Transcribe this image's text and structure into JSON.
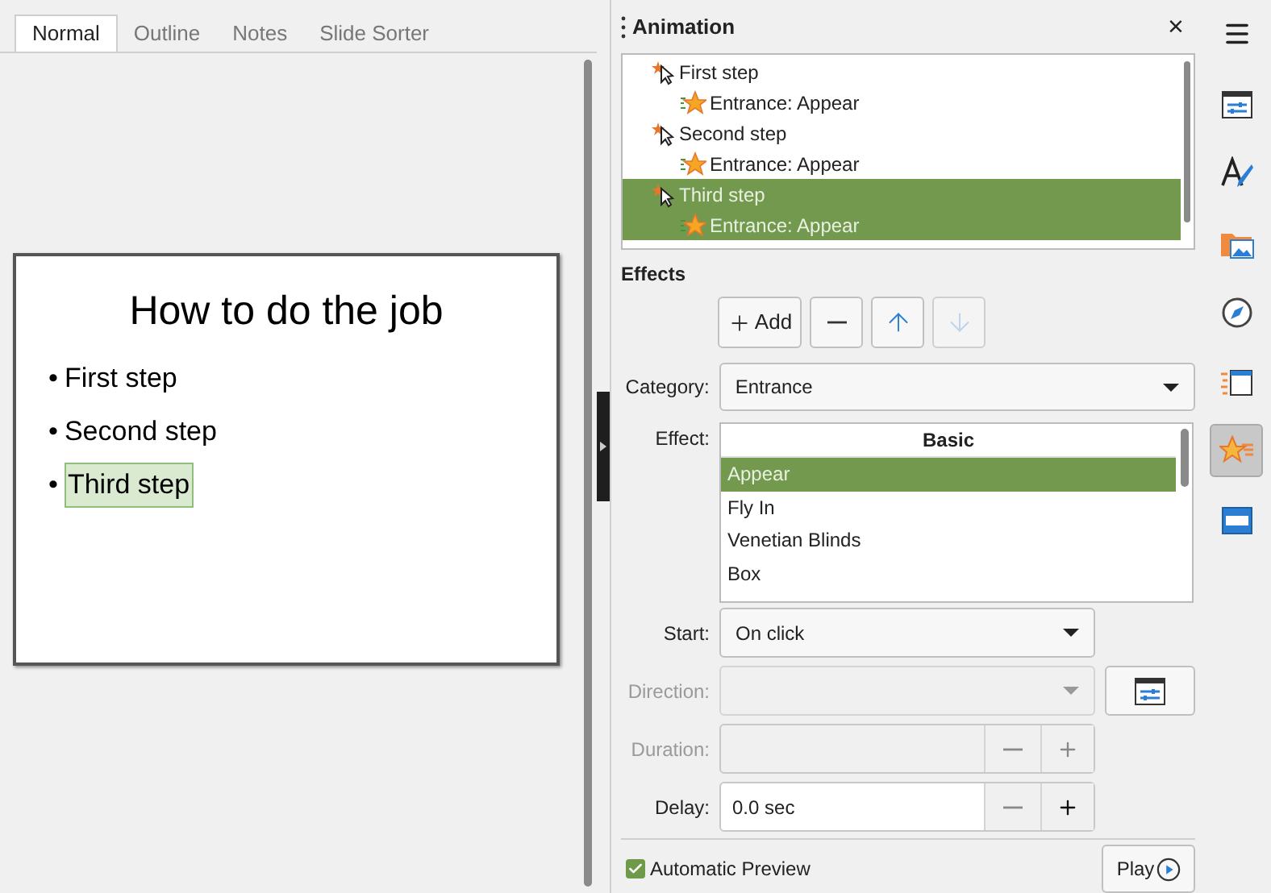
{
  "view_tabs": [
    {
      "label": "Normal",
      "selected": true
    },
    {
      "label": "Outline",
      "selected": false
    },
    {
      "label": "Notes",
      "selected": false
    },
    {
      "label": "Slide Sorter",
      "selected": false
    }
  ],
  "slide": {
    "title": "How to do the job",
    "bullets": [
      {
        "bullet": "•",
        "text": "First step",
        "highlighted": false
      },
      {
        "bullet": "•",
        "text": "Second step",
        "highlighted": false
      },
      {
        "bullet": "•",
        "text": "Third step",
        "highlighted": true
      }
    ]
  },
  "panel": {
    "title": "Animation",
    "close": "×"
  },
  "animation_list": [
    {
      "label": "First step",
      "selected": false,
      "children": [
        {
          "label": "Entrance: Appear",
          "selected": false
        }
      ]
    },
    {
      "label": "Second step",
      "selected": false,
      "children": [
        {
          "label": "Entrance: Appear",
          "selected": false
        }
      ]
    },
    {
      "label": "Third step",
      "selected": true,
      "children": [
        {
          "label": "Entrance: Appear",
          "selected": true
        }
      ]
    }
  ],
  "effects": {
    "heading": "Effects",
    "buttons": [
      {
        "kind": "add",
        "label": "Add",
        "disabled": false
      },
      {
        "kind": "remove",
        "disabled": false
      },
      {
        "kind": "up",
        "disabled": false
      },
      {
        "kind": "down",
        "disabled": true
      }
    ],
    "category": {
      "label": "Category:",
      "value": "Entrance"
    },
    "effect": {
      "label": "Effect:",
      "group": "Basic",
      "items": [
        {
          "label": "Appear",
          "selected": true
        },
        {
          "label": "Fly In",
          "selected": false
        },
        {
          "label": "Venetian Blinds",
          "selected": false
        },
        {
          "label": "Box",
          "selected": false
        }
      ]
    },
    "start": {
      "label": "Start:",
      "value": "On click",
      "disabled": false
    },
    "direction": {
      "label": "Direction:",
      "disabled": true
    },
    "duration": {
      "label": "Duration:",
      "disabled": true
    },
    "delay": {
      "label": "Delay:",
      "value": "0.0 sec",
      "disabled": false
    },
    "automatic_preview": {
      "label": "Automatic Preview",
      "checked": true
    },
    "play": {
      "label": "Play"
    }
  },
  "sidebar_tabs": [
    {
      "kind": "properties",
      "selected": false
    },
    {
      "kind": "styles",
      "selected": false
    },
    {
      "kind": "gallery",
      "selected": false
    },
    {
      "kind": "navigator",
      "selected": false
    },
    {
      "kind": "transition",
      "selected": false
    },
    {
      "kind": "animation",
      "selected": true
    },
    {
      "kind": "master",
      "selected": false
    }
  ]
}
